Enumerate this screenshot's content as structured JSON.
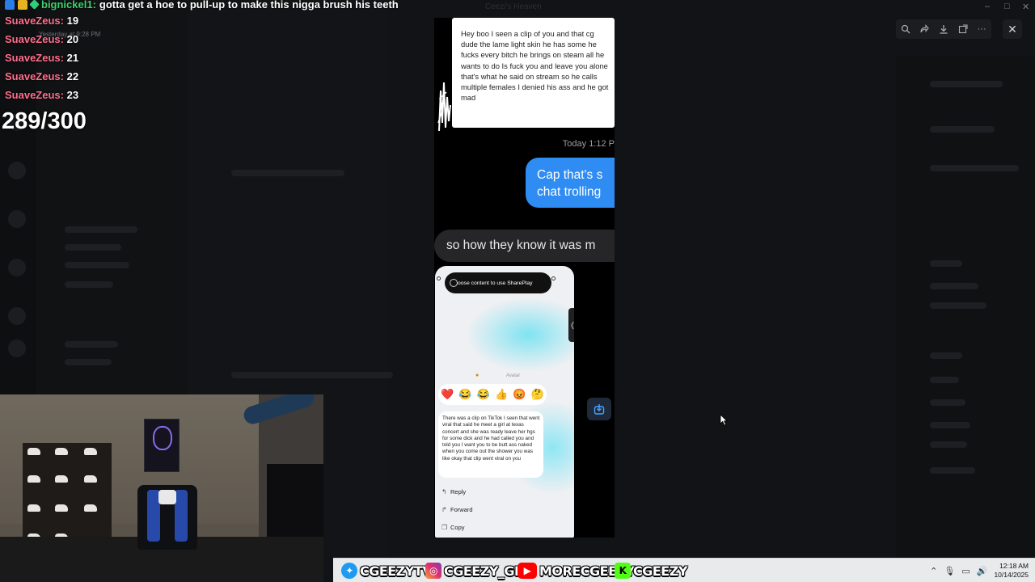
{
  "window": {
    "title": "Ceezi's Heaven"
  },
  "overlay": {
    "top_message": {
      "user": "bignickel1",
      "text": "gotta get a hoe to pull-up to make this nigga brush his teeth"
    },
    "faint_timestamp": "Yesterday at 9:28 PM",
    "chat": [
      {
        "user": "SuaveZeus:",
        "text": "19"
      },
      {
        "user": "SuaveZeus:",
        "text": "20"
      },
      {
        "user": "SuaveZeus:",
        "text": "21"
      },
      {
        "user": "SuaveZeus:",
        "text": "22"
      },
      {
        "user": "SuaveZeus:",
        "text": "23"
      }
    ],
    "counter": "289/300"
  },
  "viewer": {
    "tools": [
      "zoom-icon",
      "forward-icon",
      "download-icon",
      "open-external-icon",
      "more-icon"
    ],
    "close_icon": "close-icon"
  },
  "screenshot": {
    "card_text": "Hey boo I seen a clip of you and that cg dude the lame light skin he has some he fucks every bitch he brings on steam all he wants to do Is fuck you and leave you alone that's what he said on stream so he calls multiple females I denied his ass and he got mad",
    "timestamp": "Today 1:12 P",
    "blue_bubble": [
      "Cap that's s",
      "chat trolling"
    ],
    "grey_bubble": "so how they know it was m",
    "phone": {
      "shareplay": "oose content to use SharePlay",
      "reaction_label": "Avatar",
      "reactions": [
        "❤️",
        "😂",
        "😂",
        "👍",
        "😡",
        "🤔"
      ],
      "dm_text": "There was a clip on TikTok I seen that went viral that said he meet a girl at texas concert and she was ready leave her hgs for some dick and he had called you and told you I want you to be butt ass naked when you come out the shower you was like okay that clip went viral on you",
      "menu": [
        {
          "label": "Reply",
          "icon": "reply-icon"
        },
        {
          "label": "Forward",
          "icon": "forward-icon"
        },
        {
          "label": "Copy",
          "icon": "copy-icon"
        }
      ]
    }
  },
  "taskbar": {
    "socials": [
      {
        "handle": "CGEEZYTV",
        "icon": "twitter-icon"
      },
      {
        "handle": "CGEEZY_GBC",
        "icon": "instagram-icon"
      },
      {
        "handle": "MORECGEEZY",
        "icon": "youtube-icon"
      },
      {
        "handle": "CGEEZY",
        "icon": "kick-icon"
      }
    ],
    "time": "12:18 AM",
    "date": "10/14/2025"
  }
}
